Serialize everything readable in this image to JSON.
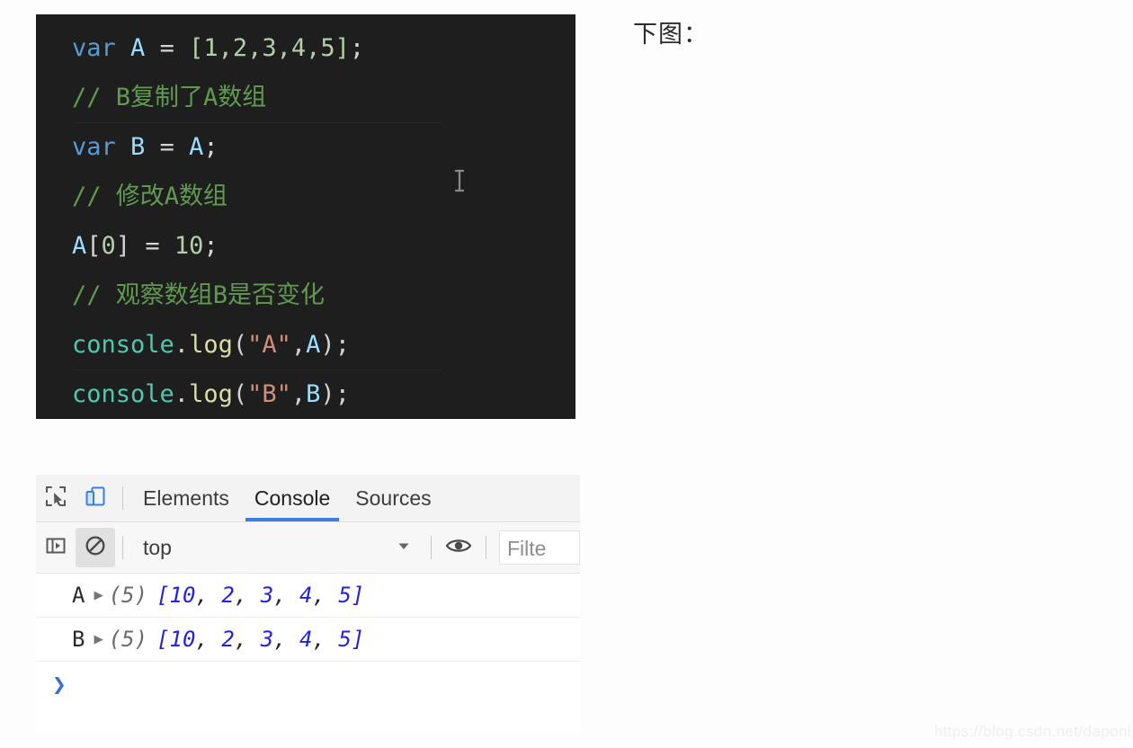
{
  "code_block": {
    "language": "javascript",
    "background": "#1e1e1e",
    "lines": [
      {
        "id": "line-1",
        "text": "var A = [1,2,3,4,5];"
      },
      {
        "id": "line-2",
        "text": "// B复制了A数组"
      },
      {
        "id": "line-3",
        "text": "var B = A;"
      },
      {
        "id": "line-4",
        "text": "// 修改A数组"
      },
      {
        "id": "line-5",
        "text": "A[0] = 10;"
      },
      {
        "id": "line-6",
        "text": "// 观察数组B是否变化"
      },
      {
        "id": "line-7",
        "text": "console.log(\"A\",A);"
      },
      {
        "id": "line-8",
        "text": "console.log(\"B\",B);"
      }
    ],
    "tokens": {
      "kw_var": "var",
      "var_a": "A",
      "var_b": "B",
      "eq": " = ",
      "array_literal": "[1,2,3,4,5]",
      "semicolon": ";",
      "comment_1": "// B复制了A数组",
      "comment_2": "// 修改A数组",
      "comment_3": "// 观察数组B是否变化",
      "index_open": "[",
      "index_zero": "0",
      "index_close": "]",
      "num_ten": "10",
      "console_obj": "console",
      "dot": ".",
      "log_fn": "log",
      "paren_open": "(",
      "str_a": "\"A\"",
      "str_b": "\"B\"",
      "comma": ",",
      "paren_close": ")"
    },
    "colors": {
      "keyword": "#569cd6",
      "variable": "#9cdcfe",
      "number": "#b5cea8",
      "comment": "#5f9a4e",
      "function": "#dcdcaa",
      "object": "#4ec9b0",
      "string": "#ce9178",
      "plain": "#d4d4d4"
    }
  },
  "note": {
    "text": "下图："
  },
  "devtools": {
    "toolbar": {
      "inspect_icon": "inspect-element-icon",
      "device_icon": "device-toolbar-icon"
    },
    "tabs": [
      {
        "label": "Elements",
        "active": false
      },
      {
        "label": "Console",
        "active": true
      },
      {
        "label": "Sources",
        "active": false
      }
    ],
    "active_tab_underline_color": "#3c7fe0",
    "filter_bar": {
      "sidebar_toggle_icon": "console-sidebar-icon",
      "clear_icon": "clear-console-icon",
      "context_label": "top",
      "caret_icon": "chevron-down-icon",
      "eye_icon": "live-expression-eye-icon",
      "filter_placeholder": "Filte"
    },
    "console_rows": [
      {
        "label": "A",
        "expand_arrow": "▶",
        "count": "(5)",
        "open_bracket": "[",
        "values": [
          "10",
          "2",
          "3",
          "4",
          "5"
        ],
        "close_bracket": "]",
        "highlight_index": 0
      },
      {
        "label": "B",
        "expand_arrow": "▶",
        "count": "(5)",
        "open_bracket": "[",
        "values": [
          "10",
          "2",
          "3",
          "4",
          "5"
        ],
        "close_bracket": "]",
        "highlight_index": 0
      }
    ],
    "prompt": {
      "chevron": "❯",
      "value": ""
    },
    "colors": {
      "array_value": "#2323dc",
      "count": "#6b6b6b",
      "prompt": "#3b6fd4"
    }
  },
  "watermark": {
    "text": "https://blog.csdn.net/daponi"
  }
}
